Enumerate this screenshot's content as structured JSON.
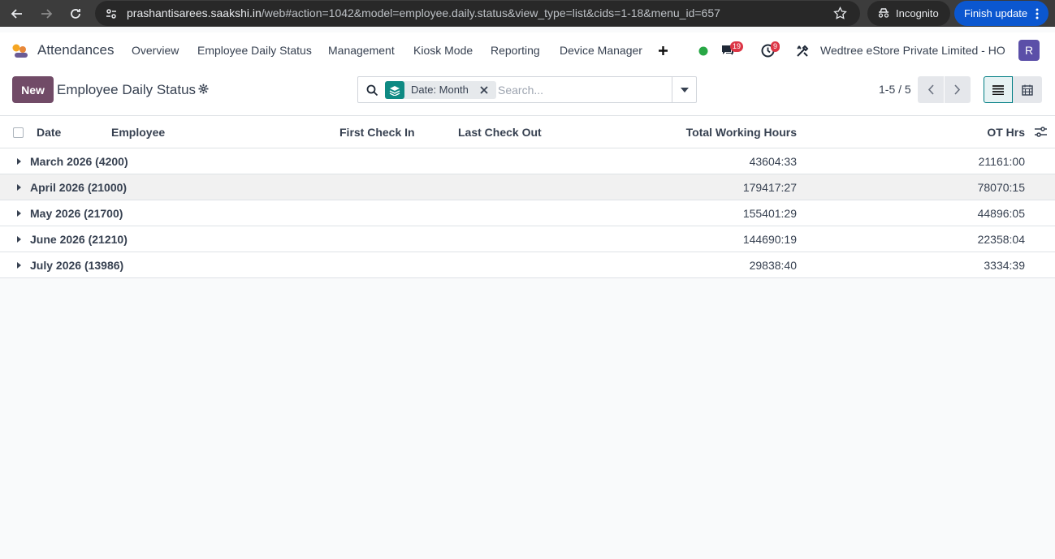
{
  "browser": {
    "url_host": "prashantisarees.saakshi.in",
    "url_rest": "/web#action=1042&model=employee.daily.status&view_type=list&cids=1-18&menu_id=657",
    "incognito_label": "Incognito",
    "update_label": "Finish update"
  },
  "navbar": {
    "app_name": "Attendances",
    "menu": [
      "Overview",
      "Employee Daily Status",
      "Management",
      "Kiosk Mode",
      "Reporting",
      "Device Manager"
    ],
    "messages_count": "19",
    "activities_count": "9",
    "company": "Wedtree eStore Private Limited - HO",
    "avatar_letter": "R"
  },
  "control_panel": {
    "new_label": "New",
    "title": "Employee Daily Status",
    "facet_label": "Date: Month",
    "search_placeholder": "Search...",
    "pager": "1-5 / 5"
  },
  "table": {
    "headers": {
      "date": "Date",
      "employee": "Employee",
      "first_check_in": "First Check In",
      "last_check_out": "Last Check Out",
      "total_working_hours": "Total Working Hours",
      "ot_hrs": "OT Hrs"
    },
    "groups": [
      {
        "name": "March 2026 (4200)",
        "total_hours": "43604:33",
        "ot_hrs": "21161:00"
      },
      {
        "name": "April 2026 (21000)",
        "total_hours": "179417:27",
        "ot_hrs": "78070:15"
      },
      {
        "name": "May 2026 (21700)",
        "total_hours": "155401:29",
        "ot_hrs": "44896:05"
      },
      {
        "name": "June 2026 (21210)",
        "total_hours": "144690:19",
        "ot_hrs": "22358:04"
      },
      {
        "name": "July 2026 (13986)",
        "total_hours": "29838:40",
        "ot_hrs": "3334:39"
      }
    ]
  },
  "colors": {
    "brand": "#714b67",
    "facet_accent": "#0f8a83",
    "badge": "#dc3545",
    "avatar": "#5b4fa8",
    "status_online": "#28a745"
  }
}
